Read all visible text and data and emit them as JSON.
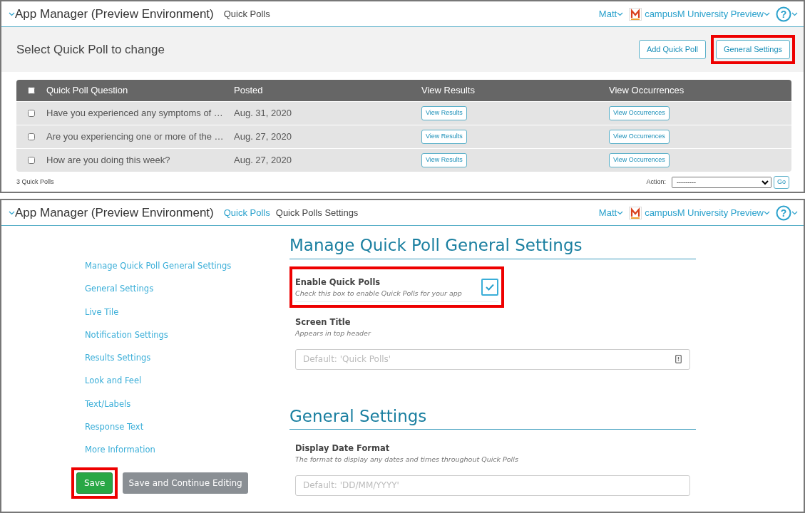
{
  "list_page": {
    "header": {
      "app_title": "App Manager (Preview Environment)",
      "breadcrumbs": [
        {
          "label": "Quick Polls",
          "link": false
        }
      ],
      "user": "Matt",
      "org": "campusM University Preview",
      "help": "?"
    },
    "title": "Select Quick Poll to change",
    "buttons": [
      {
        "label": "Add Quick Poll",
        "highlighted": false
      },
      {
        "label": "General Settings",
        "highlighted": true
      }
    ],
    "table": {
      "columns": [
        "Quick Poll Question",
        "Posted",
        "View Results",
        "View Occurrences"
      ],
      "all_checked": false,
      "rows": [
        {
          "question": "Have you experienced any symptoms of …",
          "posted": "Aug. 31, 2020",
          "results": "View Results",
          "occurrences": "View Occurrences",
          "checked": false
        },
        {
          "question": "Are you experiencing one or more of the …",
          "posted": "Aug. 27, 2020",
          "results": "View Results",
          "occurrences": "View Occurrences",
          "checked": false
        },
        {
          "question": "How are you doing this week?",
          "posted": "Aug. 27, 2020",
          "results": "View Results",
          "occurrences": "View Occurrences",
          "checked": false
        }
      ]
    },
    "count": "3 Quick Polls",
    "action_label": "Action:",
    "action_value": "---------",
    "go": "Go"
  },
  "settings_page": {
    "header": {
      "app_title": "App Manager (Preview Environment)",
      "breadcrumbs": [
        {
          "label": "Quick Polls",
          "link": true
        },
        {
          "label": "Quick Polls Settings",
          "link": false
        }
      ],
      "user": "Matt",
      "org": "campusM University Preview",
      "help": "?"
    },
    "sidebar": {
      "items": [
        "Manage Quick Poll General Settings",
        "General Settings",
        "Live Tile",
        "Notification Settings",
        "Results Settings",
        "Look and Feel",
        "Text/Labels",
        "Response Text",
        "More Information"
      ]
    },
    "buttons": [
      {
        "label": "Save",
        "kind": "primary",
        "highlighted": true
      },
      {
        "label": "Save and Continue Editing",
        "kind": "secondary",
        "highlighted": false
      }
    ],
    "sections": [
      {
        "title": "Manage Quick Poll General Settings",
        "fields": [
          {
            "kind": "checkbox",
            "label": "Enable Quick Polls",
            "help": "Check this box to enable Quick Polls for your app",
            "checked": true,
            "highlighted": true
          },
          {
            "kind": "text",
            "label": "Screen Title",
            "help": "Appears in top header",
            "placeholder": "Default: 'Quick Polls'",
            "highlighted": false
          }
        ]
      },
      {
        "title": "General Settings",
        "fields": [
          {
            "kind": "text",
            "label": "Display Date Format",
            "help": "The format to display any dates and times throughout Quick Polls",
            "placeholder": "Default: 'DD/MM/YYYY'",
            "highlighted": false
          }
        ]
      }
    ]
  }
}
